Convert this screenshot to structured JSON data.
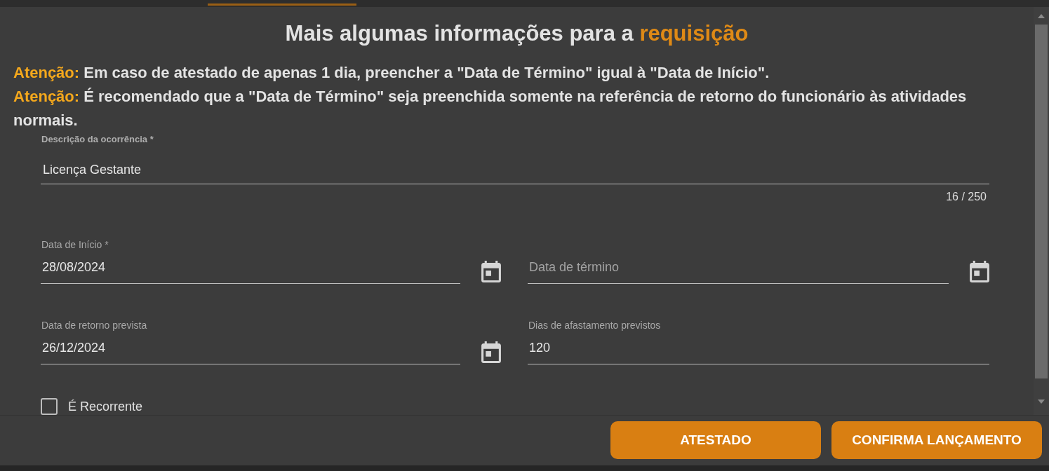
{
  "title": {
    "text": "Mais algumas informações para a",
    "highlight": "requisição"
  },
  "warnings": [
    {
      "label": "Atenção:",
      "text": "Em caso de atestado de apenas 1 dia, preencher a \"Data de Término\" igual à \"Data de Início\"."
    },
    {
      "label": "Atenção:",
      "text": "É recomendado que a \"Data de Término\" seja preenchida somente na referência de retorno do funcionário às atividades normais."
    }
  ],
  "description": {
    "label": "Descrição da ocorrência *",
    "value": "Licença Gestante",
    "counter": "16 / 250"
  },
  "fields": [
    {
      "kind": "date",
      "label": "Data de Início *",
      "value": "28/08/2024"
    },
    {
      "kind": "date",
      "placeholder": "Data de término"
    },
    {
      "kind": "date",
      "label": "Data de retorno prevista",
      "value": "26/12/2024"
    },
    {
      "kind": "number",
      "label": "Dias de afastamento previstos",
      "value": "120"
    }
  ],
  "checkbox": {
    "label": "É Recorrente",
    "checked": false
  },
  "buttons": [
    {
      "label": "ATESTADO"
    },
    {
      "label": "CONFIRMA LANÇAMENTO"
    }
  ]
}
